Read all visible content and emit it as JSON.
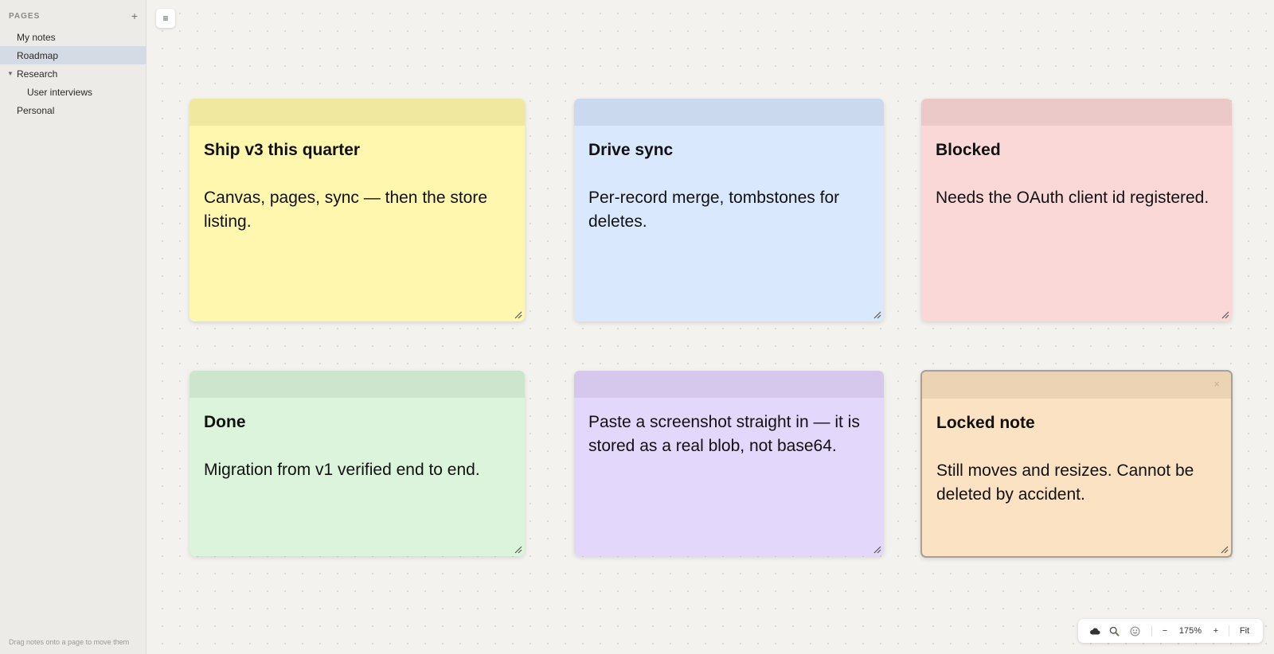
{
  "sidebar": {
    "title": "PAGES",
    "add_icon": "plus-icon",
    "items": [
      {
        "label": "My notes"
      },
      {
        "label": "Roadmap"
      },
      {
        "label": "Research"
      },
      {
        "label": "User interviews"
      },
      {
        "label": "Personal"
      }
    ],
    "footer": "Drag notes onto a page to move them"
  },
  "toggle": {
    "icon": "menu-icon",
    "glyph": "≡"
  },
  "notes": [
    {
      "title": "Ship v3 this quarter",
      "text": "Canvas, pages, sync — then the store listing.",
      "color": "#fff7ae",
      "bar": "#f0e89f"
    },
    {
      "title": "Drive sync",
      "text": "Per-record merge, tombstones for deletes.",
      "color": "#dae8fd",
      "bar": "#cbd9ee"
    },
    {
      "title": "Blocked",
      "text": "Needs the OAuth client id registered.",
      "color": "#fbd8d8",
      "bar": "#ecc9c9"
    },
    {
      "title": "Done",
      "text": "Migration from v1 verified end to end.",
      "color": "#dbf4db",
      "bar": "#cde5cd"
    },
    {
      "title": "",
      "text": "Paste a screenshot straight in — it is stored as a real blob, not base64.",
      "color": "#e3d7fc",
      "bar": "#d5c8ec"
    },
    {
      "title": "Locked note",
      "text": "Still moves and resizes. Cannot be deleted by accident.",
      "color": "#fbe2c2",
      "bar": "#ebd3b4",
      "close": "×"
    }
  ],
  "toolbar": {
    "cloud_icon": "cloud-icon",
    "search_icon": "search-icon",
    "emoji_icon": "smiley-icon",
    "zoom_out": "−",
    "zoom": "175%",
    "zoom_in": "+",
    "fit": "Fit"
  }
}
